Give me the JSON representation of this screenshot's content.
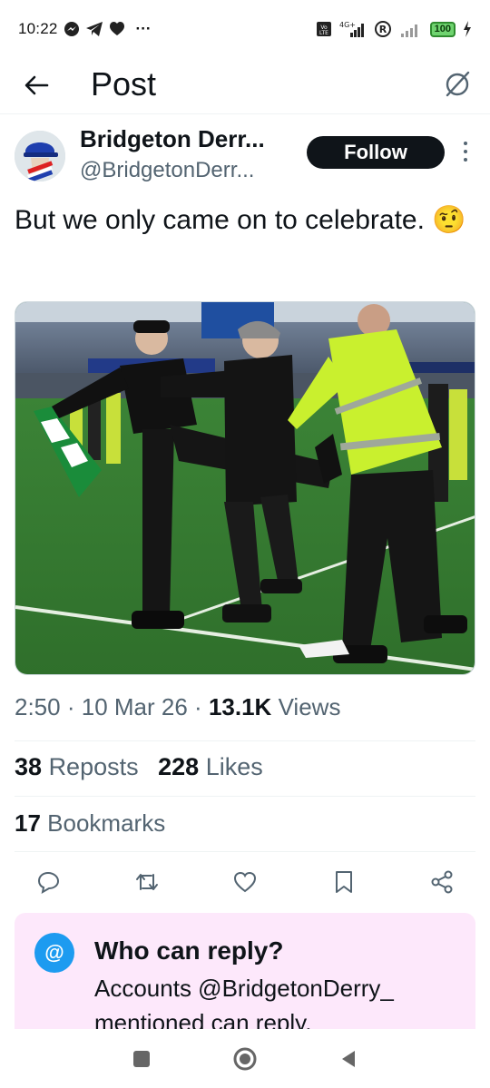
{
  "status_bar": {
    "time": "10:22",
    "overflow": "···",
    "battery": "100"
  },
  "header": {
    "title": "Post"
  },
  "author": {
    "name": "Bridgeton Derr...",
    "handle": "@BridgetonDerr...",
    "follow_label": "Follow"
  },
  "tweet": {
    "text": "But we only came on to celebrate. 🤨",
    "time": "2:50",
    "date": "10 Mar 26",
    "views_count": "13.1K",
    "views_label": "Views",
    "reposts_count": "38",
    "reposts_label": "Reposts",
    "likes_count": "228",
    "likes_label": "Likes",
    "bookmarks_count": "17",
    "bookmarks_label": "Bookmarks"
  },
  "reply_restriction": {
    "icon_text": "@",
    "title": "Who can reply?",
    "body": "Accounts @BridgetonDerry_ mentioned can reply."
  },
  "colors": {
    "accent": "#1d9bf0",
    "text": "#0f1419",
    "secondary": "#536471",
    "reply_box_bg": "#fde8fb"
  },
  "icons": [
    "back-arrow-icon",
    "grok-icon",
    "more-icon",
    "reply-icon",
    "repost-icon",
    "like-icon",
    "bookmark-icon",
    "share-icon",
    "nav-recents-icon",
    "nav-home-icon",
    "nav-back-icon"
  ]
}
